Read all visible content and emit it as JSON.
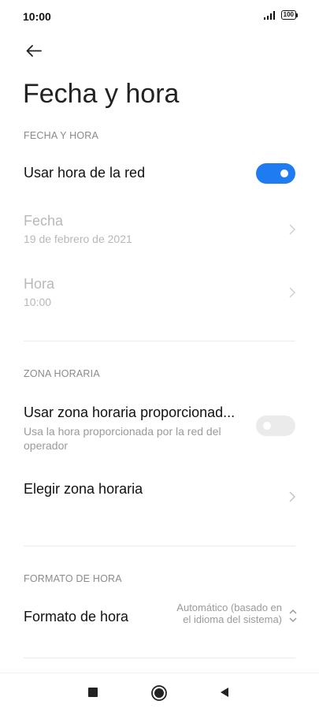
{
  "status": {
    "time": "10:00",
    "battery": "100"
  },
  "icons": {
    "back": "arrow-left-icon",
    "chevron": "chevron-right-icon",
    "updown": "chevron-up-down-icon"
  },
  "colors": {
    "accent": "#1f7bf2"
  },
  "page": {
    "title": "Fecha y hora"
  },
  "sections": {
    "date_time": "FECHA Y HORA",
    "time_zone": "ZONA HORARIA",
    "time_format": "FORMATO DE HORA"
  },
  "settings": {
    "use_network_time": {
      "label": "Usar hora de la red",
      "enabled": true
    },
    "date": {
      "label": "Fecha",
      "value": "19 de febrero de 2021"
    },
    "time": {
      "label": "Hora",
      "value": "10:00"
    },
    "use_network_zone": {
      "label": "Usar zona horaria proporcionad...",
      "description": "Usa la hora proporcionada por la red del operador",
      "enabled": false
    },
    "choose_zone": {
      "label": "Elegir zona horaria"
    },
    "time_format": {
      "label": "Formato de hora",
      "value": "Automático (basado en el idioma del sistema)"
    }
  },
  "navbar": {
    "items": [
      "recents-square-icon",
      "home-circle-icon",
      "back-triangle-icon"
    ]
  }
}
